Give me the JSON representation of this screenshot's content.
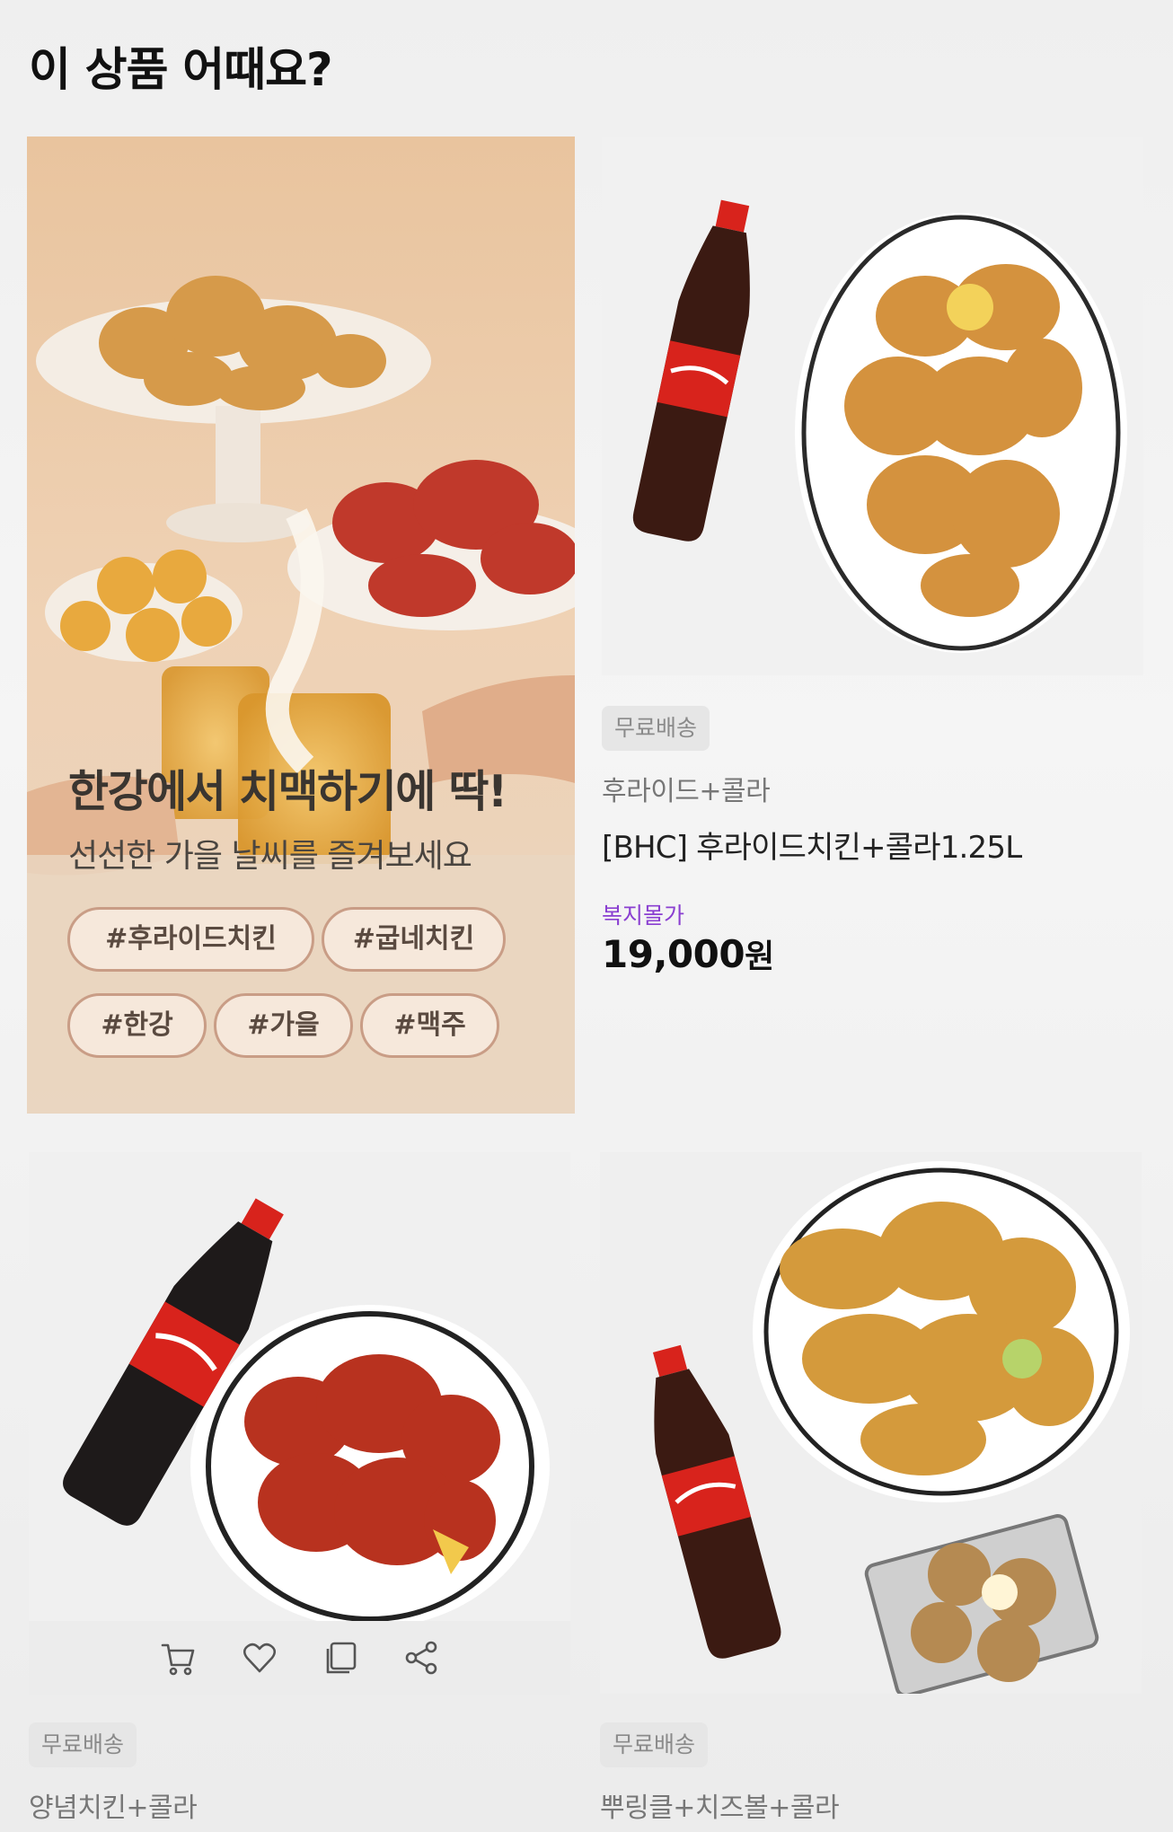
{
  "section": {
    "title": "이 상품 어때요?"
  },
  "banner": {
    "title": "한강에서 치맥하기에 딱!",
    "subtitle": "선선한 가을 날씨를 즐겨보세요",
    "tags": [
      "#후라이드치킨",
      "#굽네치킨",
      "#한강",
      "#가을",
      "#맥주"
    ]
  },
  "products": [
    {
      "badge": "무료배송",
      "sub_name": "후라이드+콜라",
      "name": "[BHC] 후라이드치킨+콜라1.25L",
      "price_label": "복지몰가",
      "price": "19,000",
      "currency": "원"
    },
    {
      "badge": "무료배송",
      "sub_name": "양념치킨+콜라"
    },
    {
      "badge": "무료배송",
      "sub_name": "뿌링클+치즈볼+콜라"
    }
  ],
  "actions": {
    "icons": [
      "cart-icon",
      "heart-icon",
      "copy-icon",
      "share-icon"
    ]
  },
  "colors": {
    "price_label": "#8a3fd1",
    "badge_bg": "#e6e6e6",
    "tag_border": "#c99d86",
    "coke_red": "#d8231c"
  }
}
